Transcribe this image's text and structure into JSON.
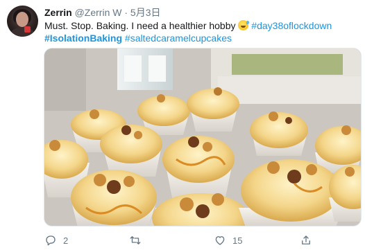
{
  "tweet": {
    "author": {
      "name": "Zerrin",
      "handle": "@Zerrin W",
      "separator": "·",
      "date": "5月3日"
    },
    "text": {
      "line1": "Must. Stop. Baking. I need a healthier hobby",
      "emoji": "sweat-smile-emoji",
      "hashtag1": "#day38oflockdown",
      "hashtag2": "#IsolationBaking",
      "hashtag3": "#saltedcaramelcupcakes"
    },
    "media": {
      "description_icon": "cupcakes-photo"
    },
    "actions": {
      "reply_count": "2",
      "retweet_count": "",
      "like_count": "15"
    },
    "colors": {
      "link": "#1b95e0",
      "muted": "#657786",
      "text": "#14171a"
    }
  }
}
